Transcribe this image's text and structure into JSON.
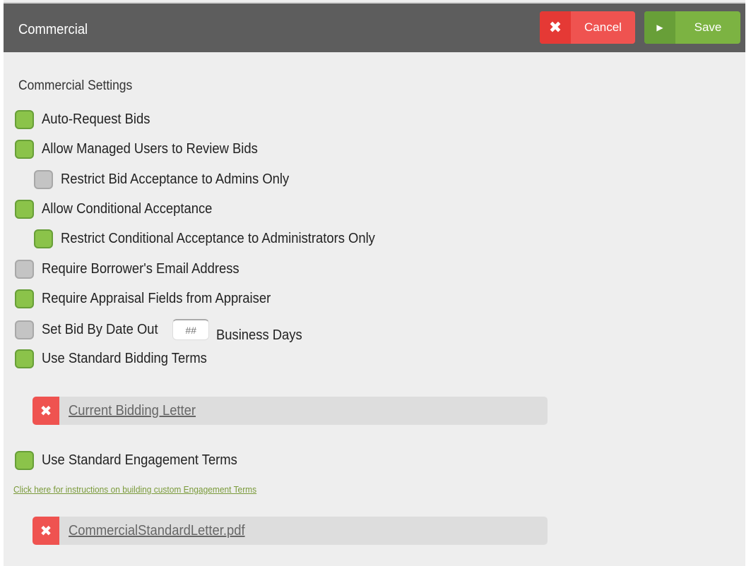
{
  "header": {
    "title": "Commercial",
    "cancel_label": "Cancel",
    "save_label": "Save"
  },
  "settings": {
    "title": "Commercial Settings",
    "options": [
      {
        "label": "Auto-Request Bids",
        "checked": true
      },
      {
        "label": "Allow Managed Users to Review Bids",
        "checked": true
      },
      {
        "label": "Restrict Bid Acceptance to Admins Only",
        "checked": false
      },
      {
        "label": "Allow Conditional Acceptance",
        "checked": true
      },
      {
        "label": "Restrict Conditional Acceptance to Administrators Only",
        "checked": true
      },
      {
        "label": "Require Borrower's Email Address",
        "checked": false
      },
      {
        "label": "Require Appraisal Fields from Appraiser",
        "checked": true
      },
      {
        "label": "Set Bid By Date Out",
        "checked": false
      },
      {
        "label": "Use Standard Bidding Terms",
        "checked": true
      },
      {
        "label": "Use Standard Engagement Terms",
        "checked": true
      }
    ],
    "bid_days": {
      "placeholder": "##",
      "value": "",
      "suffix": "Business Days"
    }
  },
  "bidding_letter": {
    "link": "Current Bidding Letter"
  },
  "engagement": {
    "help_link": "Click here for instructions on building custom Engagement Terms",
    "file": "CommercialStandardLetter.pdf"
  },
  "colors": {
    "header_bg": "#5d5d5d",
    "cancel": "#ef5350",
    "save": "#7cb342",
    "checked": "#8bc34a",
    "unchecked": "#c4c4c4"
  }
}
